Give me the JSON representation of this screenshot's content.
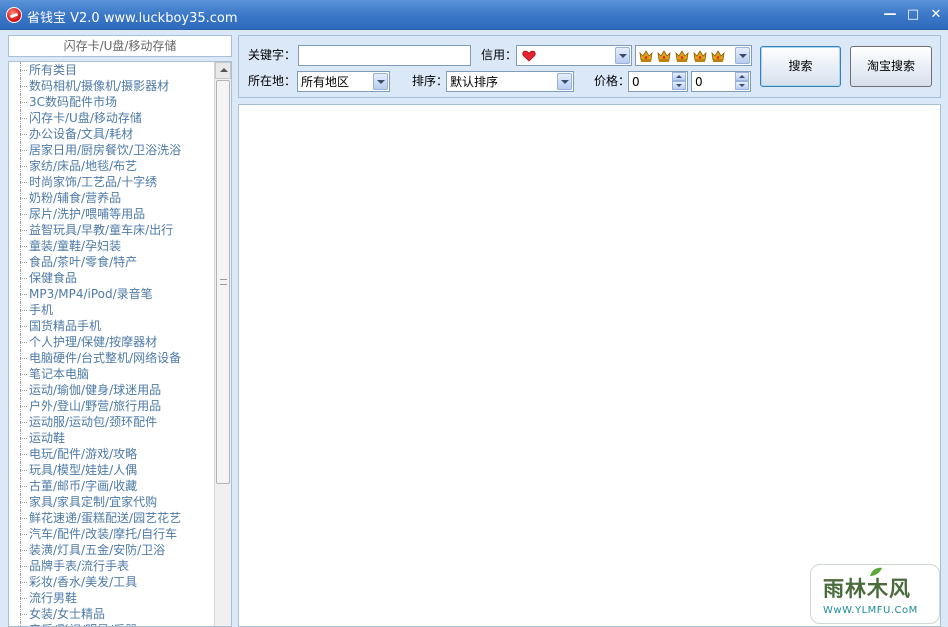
{
  "window": {
    "title": "省钱宝 V2.0 www.luckboy35.com",
    "min_glyph": "—",
    "max_glyph": "□",
    "close_glyph": "✕"
  },
  "categories": {
    "header": "闪存卡/U盘/移动存储",
    "items": [
      "所有类目",
      "数码相机/摄像机/摄影器材",
      "3C数码配件市场",
      "闪存卡/U盘/移动存储",
      "办公设备/文具/耗材",
      "居家日用/厨房餐饮/卫浴洗浴",
      "家纺/床品/地毯/布艺",
      "时尚家饰/工艺品/十字绣",
      "奶粉/辅食/营养品",
      "尿片/洗护/喂哺等用品",
      "益智玩具/早教/童车床/出行",
      "童装/童鞋/孕妇装",
      "食品/茶叶/零食/特产",
      "保健食品",
      "MP3/MP4/iPod/录音笔",
      "手机",
      "国货精品手机",
      "个人护理/保健/按摩器材",
      "电脑硬件/台式整机/网络设备",
      "笔记本电脑",
      "运动/瑜伽/健身/球迷用品",
      "户外/登山/野营/旅行用品",
      "运动服/运动包/颈环配件",
      "运动鞋",
      "电玩/配件/游戏/攻略",
      "玩具/模型/娃娃/人偶",
      "古董/邮币/字画/收藏",
      "家具/家具定制/宜家代购",
      "鲜花速递/蛋糕配送/园艺花艺",
      "汽车/配件/改装/摩托/自行车",
      "装潢/灯具/五金/安防/卫浴",
      "品牌手表/流行手表",
      "彩妆/香水/美发/工具",
      "流行男鞋",
      "女装/女士精品",
      "音乐/影视/明星/乐器"
    ]
  },
  "search": {
    "keyword_label": "关键字：",
    "keyword_value": "",
    "credit_label": "信用：",
    "credit_min_icon": "heart-icon",
    "credit_max_icon": "crown-icon",
    "credit_max_count": 5,
    "location_label": "所在地：",
    "location_value": "所有地区",
    "sort_label": "排序：",
    "sort_value": "默认排序",
    "price_label": "价格：",
    "price_min": "0",
    "price_max": "0",
    "search_button": "搜索",
    "taobao_button": "淘宝搜索"
  },
  "watermark": {
    "title": "雨林木风",
    "url": "WwW.YLMFU.CoM"
  },
  "colors": {
    "titlebar": "#3b78c8",
    "category_text": "#4e7aa6",
    "window_bg": "#dbe8f7",
    "heart": "#e8252f",
    "crown": "#e2a21a"
  }
}
